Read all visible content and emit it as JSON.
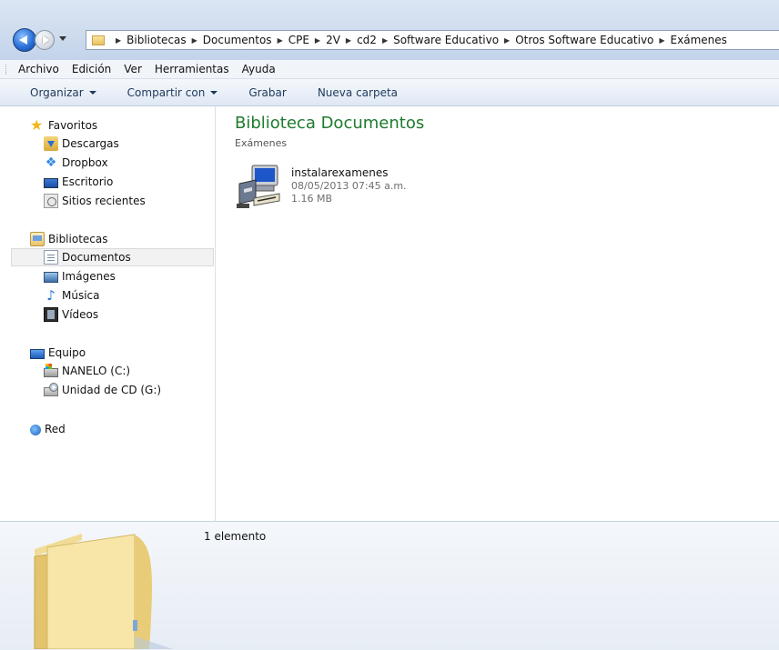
{
  "address_bar": {
    "crumbs": [
      "Bibliotecas",
      "Documentos",
      "CPE",
      "2V",
      "cd2",
      "Software Educativo",
      "Otros Software Educativo",
      "Exámenes"
    ]
  },
  "menu": [
    "Archivo",
    "Edición",
    "Ver",
    "Herramientas",
    "Ayuda"
  ],
  "toolbar": {
    "organize": "Organizar",
    "share": "Compartir con",
    "burn": "Grabar",
    "new_folder": "Nueva carpeta"
  },
  "nav": {
    "favorites": {
      "label": "Favoritos",
      "items": [
        "Descargas",
        "Dropbox",
        "Escritorio",
        "Sitios recientes"
      ]
    },
    "libraries": {
      "label": "Bibliotecas",
      "items": [
        "Documentos",
        "Imágenes",
        "Música",
        "Vídeos"
      ]
    },
    "computer": {
      "label": "Equipo",
      "items": [
        "NANELO (C:)",
        "Unidad de CD (G:)"
      ]
    },
    "network": {
      "label": "Red"
    }
  },
  "content": {
    "title": "Biblioteca Documentos",
    "subtitle": "Exámenes",
    "file": {
      "name": "instalarexamenes",
      "date": "08/05/2013 07:45 a.m.",
      "size": "1.16 MB"
    }
  },
  "details": {
    "count": "1 elemento"
  },
  "colors": {
    "title_green": "#1e7b2e",
    "selected_bg": "#f2f2f2"
  }
}
